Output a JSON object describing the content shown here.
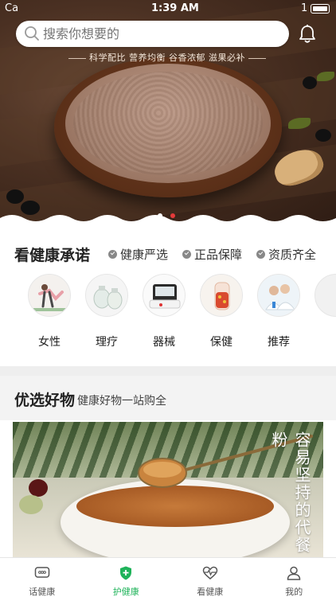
{
  "status": {
    "carrier": "Ca",
    "time": "1:39 AM",
    "battery_num": "1"
  },
  "search": {
    "placeholder": "搜索你想要的"
  },
  "hero": {
    "tagline": "科学配比 营养均衡 谷香浓郁 滋果必补"
  },
  "promise": {
    "title": "看健康承诺",
    "badges": [
      "健康严选",
      "正品保障",
      "资质齐全"
    ]
  },
  "categories": [
    {
      "label": "女性",
      "icon": "yoga-icon"
    },
    {
      "label": "理疗",
      "icon": "cupping-jar-icon"
    },
    {
      "label": "器械",
      "icon": "blood-pressure-monitor-icon"
    },
    {
      "label": "保健",
      "icon": "herbal-tea-icon"
    },
    {
      "label": "推荐",
      "icon": "doctors-icon"
    }
  ],
  "picks": {
    "title": "优选好物",
    "subtitle": "健康好物一站购全",
    "banner_text": "容易坚持的代餐粉"
  },
  "tabs": [
    {
      "label": "话健康",
      "icon": "chat-icon",
      "active": false
    },
    {
      "label": "护健康",
      "icon": "shield-plus-icon",
      "active": true
    },
    {
      "label": "看健康",
      "icon": "heart-pulse-icon",
      "active": false
    },
    {
      "label": "我的",
      "icon": "user-icon",
      "active": false
    }
  ],
  "colors": {
    "accent": "#1fb35a",
    "dot_active": "#e43a3a"
  }
}
